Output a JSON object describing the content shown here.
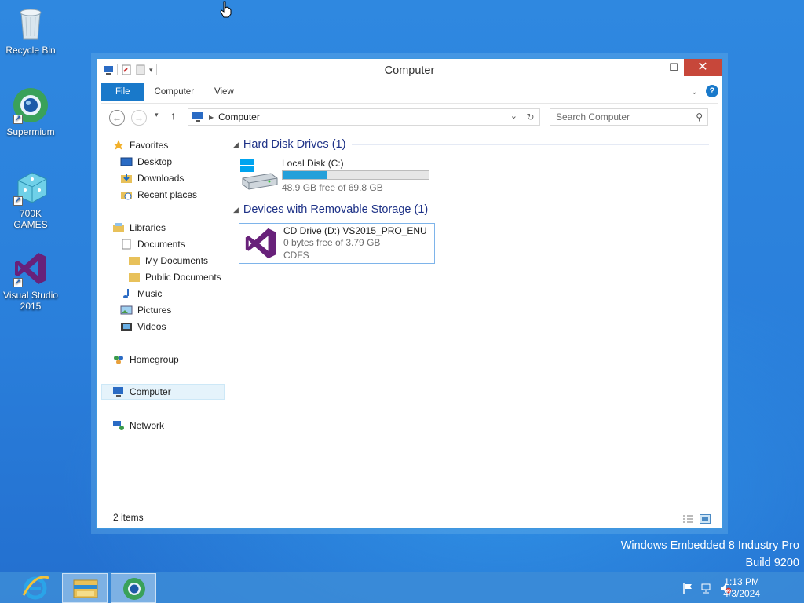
{
  "desktop": {
    "icons": [
      {
        "label": "Recycle Bin"
      },
      {
        "label": "Supermium"
      },
      {
        "label": "700K GAMES"
      },
      {
        "label": "Visual Studio 2015"
      }
    ],
    "watermark": {
      "line1": "Windows Embedded 8 Industry Pro",
      "line2": "Build 9200"
    }
  },
  "window": {
    "title": "Computer",
    "controls": {
      "minimize": "—",
      "maximize": "☐",
      "close": "✕"
    },
    "ribbon": {
      "tabs": [
        "File",
        "Computer",
        "View"
      ]
    },
    "address": {
      "path": "Computer"
    },
    "search": {
      "placeholder": "Search Computer"
    },
    "nav": {
      "favorites": "Favorites",
      "desktop": "Desktop",
      "downloads": "Downloads",
      "recent": "Recent places",
      "libraries": "Libraries",
      "documents": "Documents",
      "my_documents": "My Documents",
      "public_documents": "Public Documents",
      "music": "Music",
      "pictures": "Pictures",
      "videos": "Videos",
      "homegroup": "Homegroup",
      "computer": "Computer",
      "network": "Network"
    },
    "groups": {
      "hdd": "Hard Disk Drives (1)",
      "removable": "Devices with Removable Storage (1)"
    },
    "drives": {
      "c": {
        "name": "Local Disk (C:)",
        "free": "48.9 GB free of 69.8 GB",
        "used_fraction": 0.3
      },
      "d": {
        "name": "CD Drive (D:) VS2015_PRO_ENU",
        "free": "0 bytes free of 3.79 GB",
        "fs": "CDFS"
      }
    },
    "status": "2 items"
  },
  "taskbar": {
    "clock": {
      "time": "1:13 PM",
      "date": "4/3/2024"
    }
  },
  "colors": {
    "accent": "#1979ca",
    "close": "#c7473a",
    "vs_purple": "#68217a",
    "bar_fill": "#26a0da"
  }
}
